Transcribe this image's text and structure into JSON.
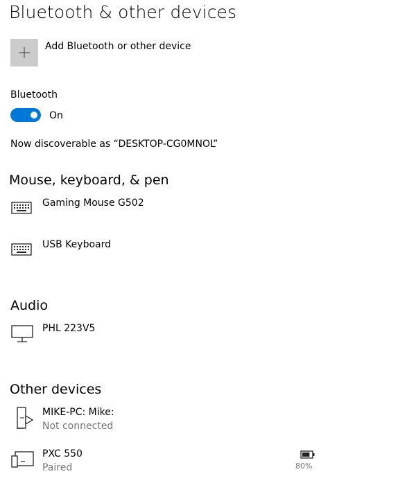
{
  "page": {
    "title": "Bluetooth & other devices"
  },
  "add_device": {
    "label": "Add Bluetooth or other device",
    "icon": "plus-icon"
  },
  "bluetooth": {
    "label": "Bluetooth",
    "state_label": "On",
    "enabled": true,
    "accent": "#0078d7",
    "discoverable_text": "Now discoverable as “DESKTOP-CG0MNOL”"
  },
  "sections": {
    "input": {
      "title": "Mouse, keyboard, & pen",
      "devices": [
        {
          "name": "Gaming Mouse G502",
          "icon": "keyboard-icon"
        },
        {
          "name": "USB Keyboard",
          "icon": "keyboard-icon"
        }
      ]
    },
    "audio": {
      "title": "Audio",
      "devices": [
        {
          "name": "PHL 223V5",
          "icon": "monitor-icon"
        }
      ]
    },
    "other": {
      "title": "Other devices",
      "devices": [
        {
          "name": "MIKE-PC: Mike:",
          "status": "Not connected",
          "icon": "phone-media-icon"
        },
        {
          "name": "PXC 550",
          "status": "Paired",
          "icon": "devices-icon",
          "battery": "80%",
          "battery_level": 0.8
        }
      ]
    }
  },
  "colors": {
    "tile": "#cccccc",
    "secondary_text": "#767676"
  }
}
